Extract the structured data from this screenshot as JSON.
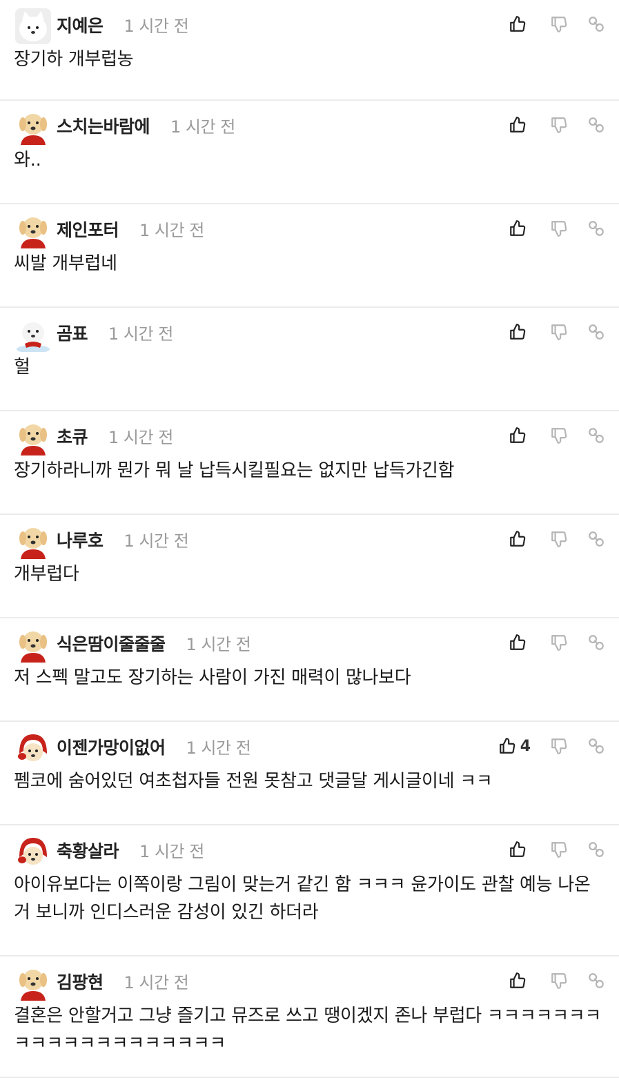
{
  "comments": [
    {
      "author": "지예은",
      "time": "1 시간 전",
      "text": "장기하 개부럽농",
      "likes": "",
      "avatar": "samoyed",
      "height": 146
    },
    {
      "author": "스치는바람에",
      "time": "1 시간 전",
      "text": "와..",
      "likes": "",
      "avatar": "puppy",
      "height": 150
    },
    {
      "author": "제인포터",
      "time": "1 시간 전",
      "text": "씨발 개부럽네",
      "likes": "",
      "avatar": "puppy",
      "height": 150
    },
    {
      "author": "곰표",
      "time": "1 시간 전",
      "text": "헐",
      "likes": "",
      "avatar": "samoyed2",
      "height": 150
    },
    {
      "author": "초큐",
      "time": "1 시간 전",
      "text": "장기하라니까 뭔가 뭐 날 납득시킬필요는 없지만 납득가긴함",
      "likes": "",
      "avatar": "puppy",
      "height": 150
    },
    {
      "author": "나루호",
      "time": "1 시간 전",
      "text": "개부럽다",
      "likes": "",
      "avatar": "puppy",
      "height": 150
    },
    {
      "author": "식은땀이줄줄줄",
      "time": "1 시간 전",
      "text": "저 스펙 말고도 장기하는 사람이 가진 매력이 많나보다",
      "likes": "",
      "avatar": "puppy",
      "height": 150
    },
    {
      "author": "이젠가망이없어",
      "time": "1 시간 전",
      "text": "펨코에 숨어있던 여초첩자들 전원 못참고 댓글달 게시글이네 ㅋㅋ",
      "likes": "4",
      "avatar": "redhood",
      "height": 150
    },
    {
      "author": "축황살라",
      "time": "1 시간 전",
      "text": "아이유보다는 이쪽이랑 그림이 맞는거 같긴 함 ㅋㅋㅋ 윤가이도 관찰 예능 나온거 보니까 인디스러운 감성이 있긴 하더라",
      "likes": "",
      "avatar": "redhood",
      "height": 190
    },
    {
      "author": "김팡현",
      "time": "1 시간 전",
      "text": "결혼은 안할거고 그냥 즐기고 뮤즈로 쓰고 땡이겠지 존나 부럽다 ㅋㅋㅋㅋㅋㅋㅋㅋㅋㅋㅋㅋㅋㅋㅋㅋㅋㅋㅋㅋ",
      "likes": "",
      "avatar": "puppy",
      "height": 176
    }
  ],
  "colors": {
    "divider": "#ebebeb",
    "meta": "#9a9a9a",
    "icon": "#222222",
    "icon_muted": "#b5b5b5"
  },
  "icons": {
    "like": "thumbs-up-icon",
    "dislike": "thumbs-down-icon",
    "link": "link-icon"
  }
}
